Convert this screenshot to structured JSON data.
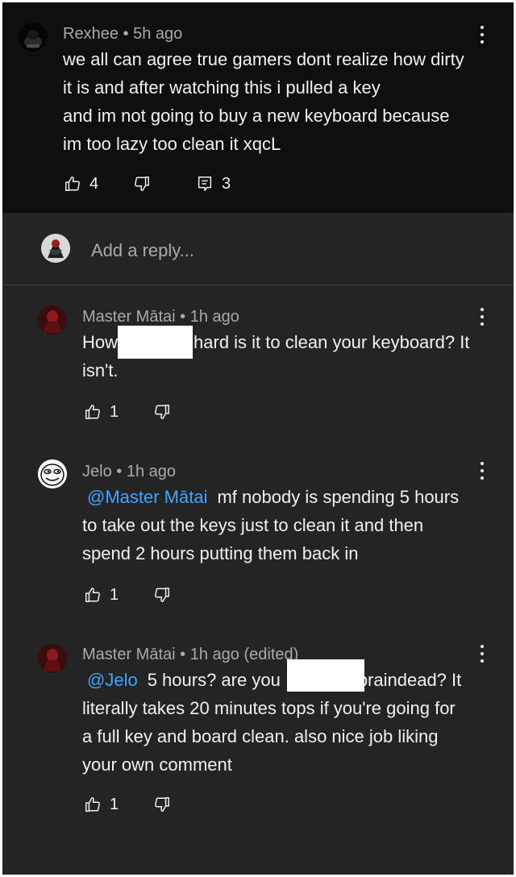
{
  "parent_comment": {
    "author": "Rexhee",
    "separator": "•",
    "time": "5h ago",
    "lines": [
      "we all can agree true gamers dont realize how dirty",
      "it is and after watching this i pulled a key",
      "and im not going to buy a new keyboard because",
      "im too lazy too clean it xqcL"
    ],
    "likes": "4",
    "replies": "3"
  },
  "reply_box": {
    "placeholder": "Add a reply..."
  },
  "replies": [
    {
      "author": "Master Mātai",
      "separator": "•",
      "time": "1h ago",
      "line1_before": "How",
      "line1_after": "hard is it to clean your keyboard? It",
      "line2": "isn't.",
      "likes": "1"
    },
    {
      "author": "Jelo",
      "separator": "•",
      "time": "1h ago",
      "mention": "@Master Mātai",
      "line1_after": "mf nobody is spending 5 hours",
      "line2": "to take out the keys just to clean it and then",
      "line3": "spend 2 hours putting them back in",
      "likes": "1"
    },
    {
      "author": "Master Mātai",
      "separator": "•",
      "time": "1h ago (edited)",
      "mention": "@Jelo",
      "line1_before": "5 hours? are you",
      "line1_after": "braindead? It",
      "line2": "literally takes 20 minutes tops if you're going for",
      "line3": "a full key and board clean. also nice job liking",
      "line4": "your own comment",
      "likes": "1"
    }
  ],
  "icons": {
    "like": "thumbs-up-icon",
    "dislike": "thumbs-down-icon",
    "reply": "comment-reply-icon",
    "more": "more-vertical-icon"
  },
  "colors": {
    "thread_background": "#0f0f0f",
    "replies_background": "#242424",
    "primary_text": "#f1f1f1",
    "secondary_text": "#aaaaaa",
    "mention": "#3ea6ff",
    "redaction": "#ffffff"
  }
}
